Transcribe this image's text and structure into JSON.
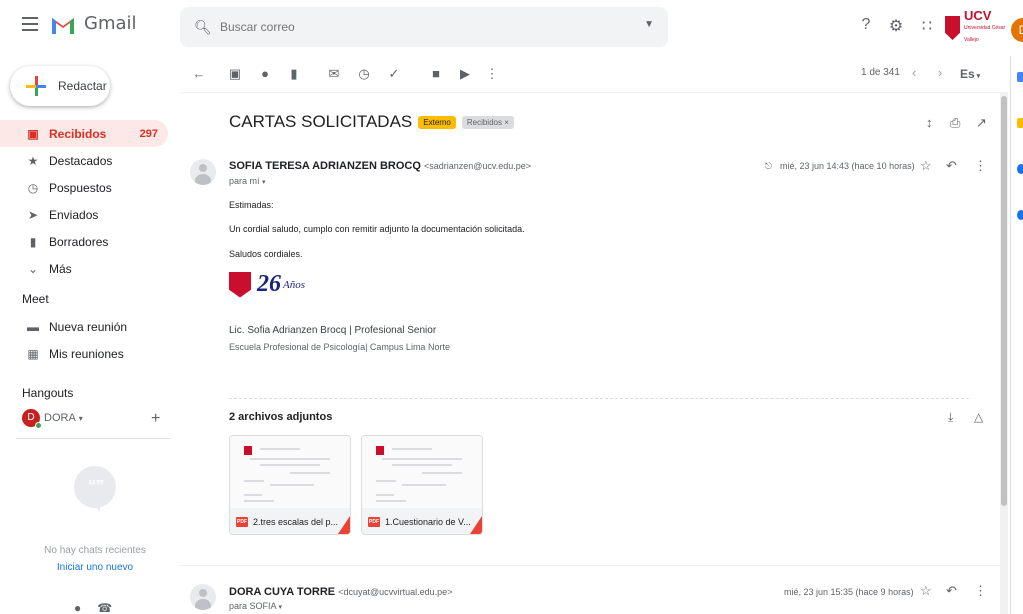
{
  "header": {
    "app_name": "Gmail",
    "search_placeholder": "Buscar correo",
    "org_name": "UCV",
    "org_sub": "Universidad César Vallejo",
    "account_initial": "D"
  },
  "sidebar": {
    "compose_label": "Redactar",
    "items": [
      {
        "label": "Recibidos",
        "count": "297",
        "icon": "inbox-icon",
        "active": true
      },
      {
        "label": "Destacados",
        "icon": "star-icon"
      },
      {
        "label": "Pospuestos",
        "icon": "clock-icon"
      },
      {
        "label": "Enviados",
        "icon": "send-icon"
      },
      {
        "label": "Borradores",
        "icon": "draft-icon"
      },
      {
        "label": "Más",
        "icon": "chevron-down-icon"
      }
    ],
    "meet": {
      "title": "Meet",
      "items": [
        {
          "label": "Nueva reunión",
          "icon": "video-icon"
        },
        {
          "label": "Mis reuniones",
          "icon": "calendar-icon"
        }
      ]
    },
    "hangouts": {
      "title": "Hangouts",
      "user": "DORA",
      "user_initial": "D",
      "no_chats": "No hay chats recientes",
      "start_new": "Iniciar uno nuevo"
    }
  },
  "toolbar": {
    "pager": "1 de 341",
    "lang": "Es"
  },
  "message": {
    "subject": "CARTAS SOLICITADAS",
    "tags": [
      "Externo",
      "Recibidos ×"
    ],
    "sender_name": "SOFIA TERESA ADRIANZEN BROCQ",
    "sender_email": "<sadrianzen@ucv.edu.pe>",
    "to": "para mí",
    "date": "mié, 23 jun 14:43 (hace 10 horas)",
    "greeting": "Estimadas:",
    "body": "Un cordial saludo, cumplo con remitir adjunto la documentación solicitada.",
    "closing": "Saludos cordiales.",
    "brand_number": "26",
    "brand_suffix": "Años",
    "signature_name": "Lic. Sofia Adrianzen Brocq  |  Profesional Senior",
    "signature_sub": "Escuela Profesional de Psicología| Campus Lima Norte",
    "attachments_title": "2 archivos adjuntos",
    "attachments": [
      {
        "name": "2.tres escalas del p...",
        "type": "PDF"
      },
      {
        "name": "1.Cuestionario de V...",
        "type": "PDF"
      }
    ]
  },
  "message2": {
    "sender_name": "DORA CUYA TORRE",
    "sender_email": "<dcuyat@ucvvirtual.edu.pe>",
    "to": "para SOFIA",
    "date": "mié, 23 jun 15:35 (hace 9 horas)"
  },
  "colors": {
    "accent_red": "#d93025",
    "ucv_red": "#c8102e",
    "external_tag": "#fbbc04"
  }
}
